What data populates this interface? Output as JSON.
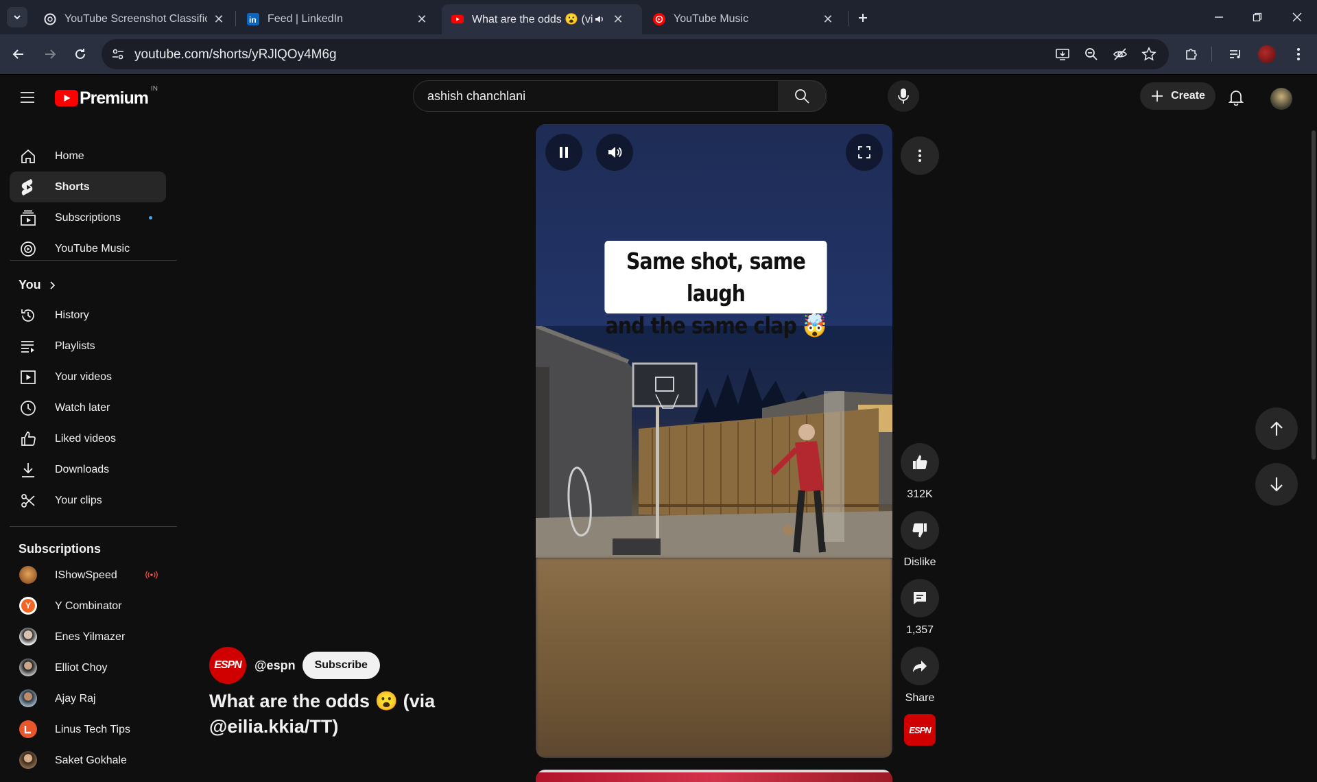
{
  "browser": {
    "tabs": [
      {
        "title": "YouTube Screenshot Classificati",
        "favicon": "chatgpt-icon"
      },
      {
        "title": "Feed | LinkedIn",
        "favicon": "linkedin-icon"
      },
      {
        "title": "What are the odds 😮 (via (",
        "favicon": "youtube-icon"
      },
      {
        "title": "YouTube Music",
        "favicon": "youtube-music-icon"
      }
    ],
    "url": "youtube.com/shorts/yRJlQOy4M6g"
  },
  "masthead": {
    "logo_text": "Premium",
    "logo_region": "IN",
    "search_value": "ashish chanchlani",
    "create_label": "Create"
  },
  "sidebar": {
    "main": [
      {
        "label": "Home",
        "icon": "home-icon"
      },
      {
        "label": "Shorts",
        "icon": "shorts-icon"
      },
      {
        "label": "Subscriptions",
        "icon": "subscriptions-icon"
      },
      {
        "label": "YouTube Music",
        "icon": "youtube-music-icon"
      }
    ],
    "you_heading": "You",
    "you": [
      {
        "label": "History",
        "icon": "history-icon"
      },
      {
        "label": "Playlists",
        "icon": "playlists-icon"
      },
      {
        "label": "Your videos",
        "icon": "your-videos-icon"
      },
      {
        "label": "Watch later",
        "icon": "watch-later-icon"
      },
      {
        "label": "Liked videos",
        "icon": "liked-videos-icon"
      },
      {
        "label": "Downloads",
        "icon": "downloads-icon"
      },
      {
        "label": "Your clips",
        "icon": "clips-icon"
      }
    ],
    "subs_heading": "Subscriptions",
    "subscriptions": [
      {
        "label": "IShowSpeed",
        "color": "#c9742c",
        "live": true
      },
      {
        "label": "Y Combinator",
        "color": "#f26522",
        "letter": "Y"
      },
      {
        "label": "Enes Yilmazer",
        "color": "#8a8f99"
      },
      {
        "label": "Elliot Choy",
        "color": "#6b6b6b"
      },
      {
        "label": "Ajay Raj",
        "color": "#5a6a7a"
      },
      {
        "label": "Linus Tech Tips",
        "color": "#e8572b"
      },
      {
        "label": "Saket Gokhale",
        "color": "#9a7a5a"
      }
    ]
  },
  "short": {
    "caption_line1": "Same shot, same laugh",
    "caption_line2": "and the same clap 🤯",
    "channel_handle": "@espn",
    "channel_logo": "ESPN",
    "subscribe_label": "Subscribe",
    "title": "What are the odds 😮 (via @eilia.kkia/TT)",
    "likes": "312K",
    "dislike_label": "Dislike",
    "comments": "1,357",
    "share_label": "Share"
  },
  "colors": {
    "youtube_red": "#ff0000",
    "espn_red": "#d00000",
    "live_red": "#ff4e45",
    "unread_blue": "#3ea6ff"
  }
}
